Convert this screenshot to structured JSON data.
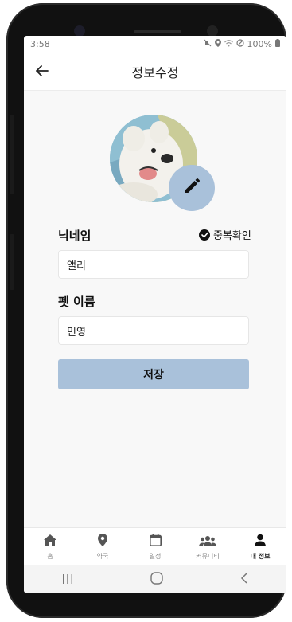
{
  "status_bar": {
    "time": "3:58",
    "battery": "100%"
  },
  "header": {
    "title": "정보수정"
  },
  "profile": {
    "nickname_label": "닉네임",
    "check_duplicate": "중복확인",
    "nickname_value": "앨리",
    "pet_name_label": "펫 이름",
    "pet_name_value": "민영",
    "save_label": "저장"
  },
  "bottom_nav": [
    {
      "label": "홈",
      "icon": "home-icon"
    },
    {
      "label": "약국",
      "icon": "location-pin-icon"
    },
    {
      "label": "일정",
      "icon": "calendar-icon"
    },
    {
      "label": "커뮤니티",
      "icon": "people-icon"
    },
    {
      "label": "내 정보",
      "icon": "person-icon",
      "active": true
    }
  ],
  "colors": {
    "accent": "#a9c1da",
    "background": "#f8f8f8"
  }
}
